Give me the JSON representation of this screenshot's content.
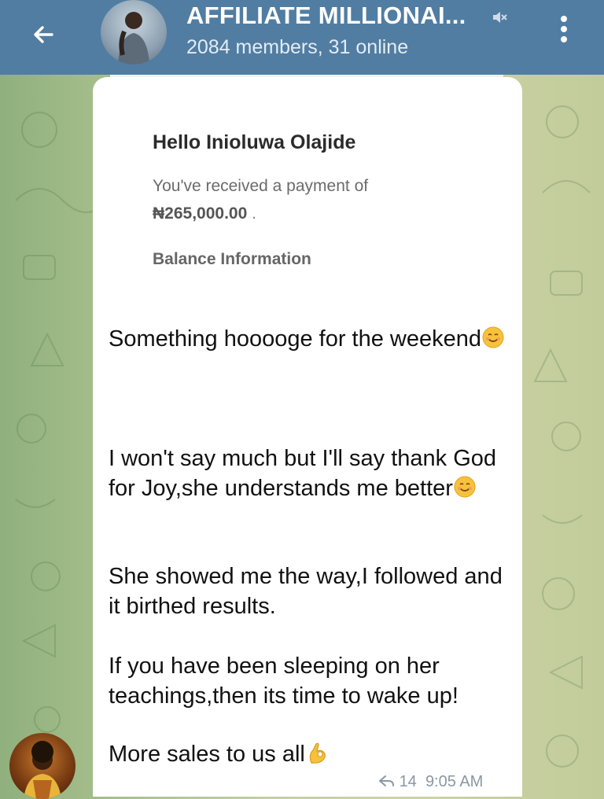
{
  "header": {
    "title": "AFFILIATE MILLIONAI...",
    "subtitle": "2084 members, 31 online",
    "bg_color": "#517da2",
    "icons": [
      "back-arrow-icon",
      "muted-icon",
      "more-vertical-icon"
    ]
  },
  "message": {
    "email_screenshot": {
      "greeting": "Hello Inioluwa Olajide",
      "received_text": "You've received a payment of",
      "amount": "₦265,000.00",
      "amount_suffix": ".",
      "balance_heading": "Balance Information"
    },
    "paragraphs": [
      "Something hooooge for the weekend",
      "I won't say much but I'll say thank God for Joy,she understands me better",
      "She showed me the way,I followed and it birthed results.",
      "If you have been sleeping on her teachings,then its time to wake up!",
      "More sales to us all"
    ],
    "emojis": [
      "smiling-face-icon",
      "smiling-face-icon",
      "ok-hand-icon"
    ],
    "shares": "14",
    "time": "9:05 AM"
  },
  "colors": {
    "bubble": "#ffffff",
    "meta_text": "#8a97a3",
    "wallpaper": "#b8c693"
  }
}
